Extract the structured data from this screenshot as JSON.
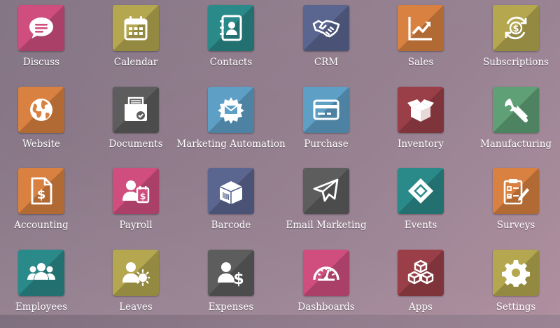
{
  "apps": [
    {
      "label": "Discuss",
      "icon": "chat-bubble-icon",
      "color": "#cf4e7e"
    },
    {
      "label": "Calendar",
      "icon": "calendar-icon",
      "color": "#b5a74f"
    },
    {
      "label": "Contacts",
      "icon": "address-book-icon",
      "color": "#2a8a89"
    },
    {
      "label": "CRM",
      "icon": "handshake-icon",
      "color": "#5a6590"
    },
    {
      "label": "Sales",
      "icon": "chart-up-icon",
      "color": "#d98140"
    },
    {
      "label": "Subscriptions",
      "icon": "recurring-dollar-icon",
      "color": "#b5a74f"
    },
    {
      "label": "Website",
      "icon": "globe-icon",
      "color": "#d98140"
    },
    {
      "label": "Documents",
      "icon": "document-box-icon",
      "color": "#5d5d5d"
    },
    {
      "label": "Marketing Automation",
      "icon": "gear-envelope-icon",
      "color": "#5e9fc6"
    },
    {
      "label": "Purchase",
      "icon": "credit-card-icon",
      "color": "#5e9fc6"
    },
    {
      "label": "Inventory",
      "icon": "open-box-icon",
      "color": "#9a3f47"
    },
    {
      "label": "Manufacturing",
      "icon": "wrench-icon",
      "color": "#5fa077"
    },
    {
      "label": "Accounting",
      "icon": "invoice-dollar-icon",
      "color": "#d98140"
    },
    {
      "label": "Payroll",
      "icon": "person-dollar-icon",
      "color": "#cf4e7e"
    },
    {
      "label": "Barcode",
      "icon": "barcode-box-icon",
      "color": "#5a6590"
    },
    {
      "label": "Email Marketing",
      "icon": "paper-plane-icon",
      "color": "#5d5d5d"
    },
    {
      "label": "Events",
      "icon": "ticket-icon",
      "color": "#2a8a89"
    },
    {
      "label": "Surveys",
      "icon": "checklist-icon",
      "color": "#d98140"
    },
    {
      "label": "Employees",
      "icon": "people-group-icon",
      "color": "#2a8a89"
    },
    {
      "label": "Leaves",
      "icon": "person-sun-icon",
      "color": "#b5a74f"
    },
    {
      "label": "Expenses",
      "icon": "person-dollar-icon",
      "color": "#5d5d5d"
    },
    {
      "label": "Dashboards",
      "icon": "speedometer-icon",
      "color": "#cf4e7e"
    },
    {
      "label": "Apps",
      "icon": "cubes-icon",
      "color": "#9a3f47"
    },
    {
      "label": "Settings",
      "icon": "gear-icon",
      "color": "#b5a74f"
    }
  ]
}
